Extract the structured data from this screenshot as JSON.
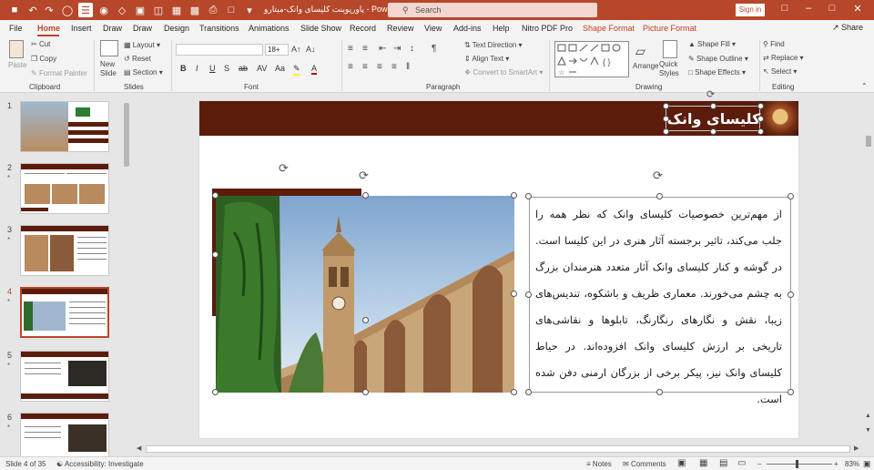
{
  "titlebar": {
    "title": "پاورپوینت کلیسای وانک-میتارو  -  PowerPoint",
    "search_placeholder": "Search",
    "signin_label": "Sign in",
    "accent": "#b7472a"
  },
  "menu": {
    "tabs": [
      "File",
      "Home",
      "Insert",
      "Draw",
      "Design",
      "Transitions",
      "Animations",
      "Slide Show",
      "Record",
      "Review",
      "View",
      "Add-ins",
      "Help",
      "Nitro PDF Pro"
    ],
    "context_tabs": [
      "Shape Format",
      "Picture Format"
    ],
    "share_label": "Share"
  },
  "ribbon": {
    "paste": "Paste",
    "cut": "Cut",
    "copy": "Copy",
    "format_painter": "Format Painter",
    "clipboard": "Clipboard",
    "new_slide": "New\nSlide",
    "layout": "Layout",
    "reset": "Reset",
    "section": "Section",
    "slides": "Slides",
    "font_size": "18+",
    "font": "Font",
    "text_direction": "Text Direction",
    "align_text": "Align Text",
    "convert_smartart": "Convert to SmartArt",
    "paragraph": "Paragraph",
    "arrange": "Arrange",
    "quick_styles": "Quick\nStyles",
    "shape_fill": "Shape Fill",
    "shape_outline": "Shape Outline",
    "shape_effects": "Shape Effects",
    "drawing": "Drawing",
    "find": "Find",
    "replace": "Replace",
    "select": "Select",
    "editing": "Editing"
  },
  "thumbnails": [
    {
      "num": "1",
      "star": ""
    },
    {
      "num": "2",
      "star": "*"
    },
    {
      "num": "3",
      "star": "*"
    },
    {
      "num": "4",
      "star": "*"
    },
    {
      "num": "5",
      "star": "*"
    },
    {
      "num": "6",
      "star": "*"
    }
  ],
  "slide": {
    "title": "کلیسای وانک",
    "body": "از مهم‌ترین خصوصیات کلیسای وانک که نظر همه را جلب می‌کند، تاثیر برجسته آثار هنری در این کلیسا است. در گوشه و کنار کلیسای وانک آثار متعدد هنرمندان بزرگ به چشم می‌خورند. معماری ظریف و باشکوه، تندیس‌های زیبا، نقش و نگارهای رنگارنگ، تابلوها و نقاشی‌های تاریخی بر ارزش کلیسای وانک افزوده‌اند. در حیاط کلیسای وانک نیز، پیکر برخی از بزرگان ارمنی دفن شده است.",
    "banner_color": "#5b1c0c"
  },
  "status": {
    "slide_info": "Slide 4 of 35",
    "accessibility": "Accessibility: Investigate",
    "notes": "Notes",
    "comments": "Comments",
    "zoom": "83%"
  }
}
